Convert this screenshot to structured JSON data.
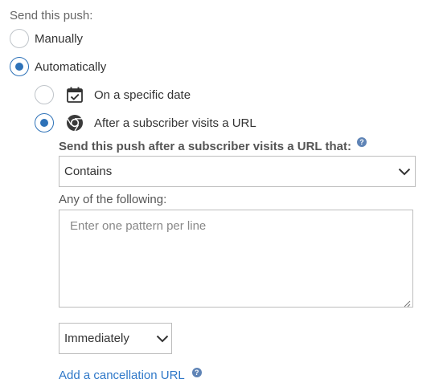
{
  "send_label": "Send this push:",
  "options": {
    "manually": {
      "label": "Manually",
      "checked": false
    },
    "automatically": {
      "label": "Automatically",
      "checked": true
    }
  },
  "sub_options": {
    "specific_date": {
      "label": "On a specific date",
      "icon": "calendar-check-icon",
      "checked": false
    },
    "visits_url": {
      "label": "After a subscriber visits a URL",
      "icon": "chrome-icon",
      "checked": true
    }
  },
  "url_condition": {
    "label": "Send this push after a subscriber visits a URL that:",
    "help": "?",
    "selected": "Contains"
  },
  "patterns": {
    "label": "Any of the following:",
    "placeholder": "Enter one pattern per line",
    "value": ""
  },
  "timing": {
    "selected": "Immediately"
  },
  "cancellation": {
    "label": "Add a cancellation URL",
    "help": "?"
  },
  "colors": {
    "accent": "#2e72b8",
    "link": "#2f78c8",
    "help_icon": "#5f84b6"
  }
}
